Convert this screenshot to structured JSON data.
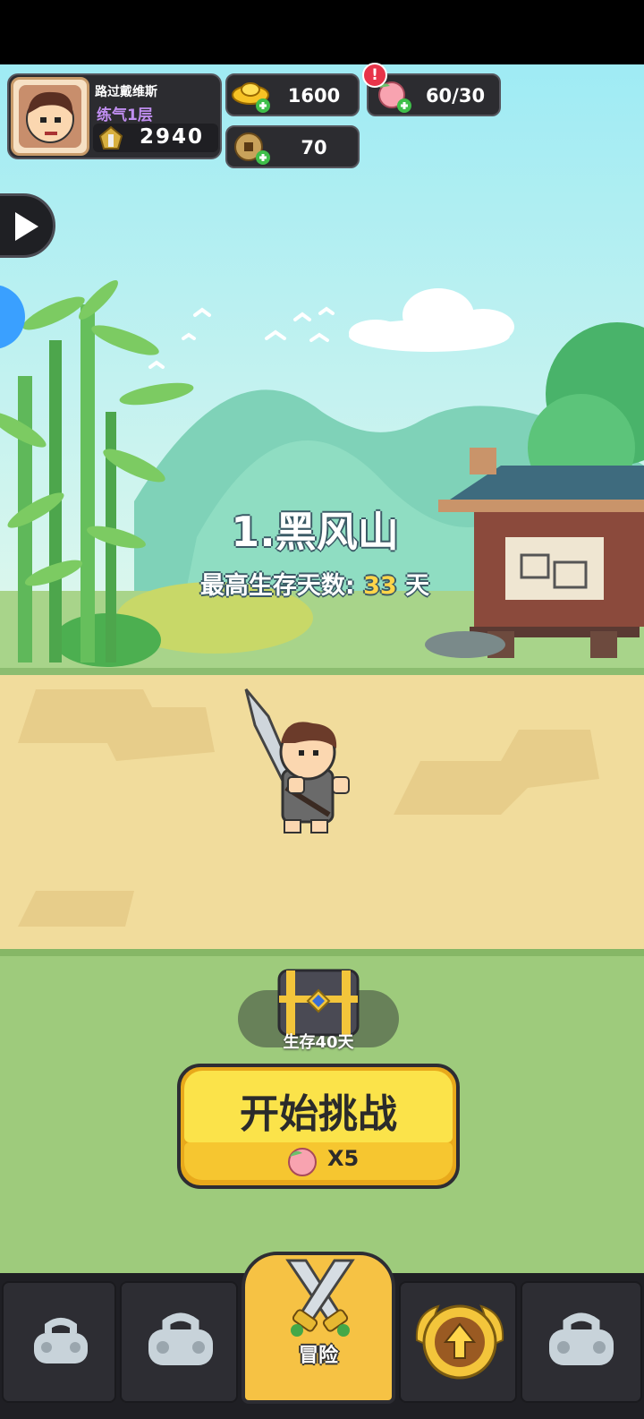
{
  "player": {
    "name": "路过戴维斯",
    "realm": "练气1层",
    "power": "2940"
  },
  "resources": {
    "gold": "1600",
    "stamina": "60/30",
    "coins": "70",
    "stamina_alert": "!"
  },
  "stage": {
    "title": "1.黑风山",
    "best_label": "最高生存天数:",
    "best_days": "33",
    "days_unit": "天"
  },
  "reward": {
    "label": "生存40天"
  },
  "start_button": {
    "label": "开始挑战",
    "cost": "X5"
  },
  "nav": {
    "center_tab_label": "冒险"
  },
  "colors": {
    "sky_top": "#a8eef5",
    "sky_bottom": "#dff7ef",
    "sand": "#f1dc9c",
    "grass": "#9ecb7c",
    "button_yellow": "#f8d62c",
    "tab_gold": "#f6c244",
    "highlight_yellow": "#ffd54a"
  }
}
